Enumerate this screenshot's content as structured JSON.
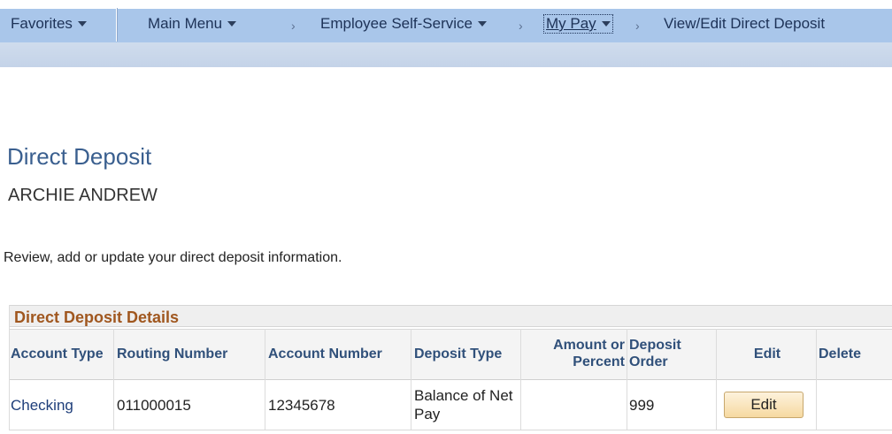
{
  "nav": {
    "favorites": "Favorites",
    "main_menu": "Main Menu",
    "employee_self_service": "Employee Self-Service",
    "my_pay": "My Pay",
    "current_page": "View/Edit Direct Deposit"
  },
  "page": {
    "title": "Direct Deposit",
    "employee_name": "ARCHIE ANDREW",
    "instructions": "Review, add or update your direct deposit information."
  },
  "grid": {
    "title": "Direct Deposit Details",
    "columns": {
      "account_type": "Account Type",
      "routing_number": "Routing Number",
      "account_number": "Account Number",
      "deposit_type": "Deposit Type",
      "amount_line1": "Amount or",
      "amount_line2": "Percent",
      "order_line1": "Deposit",
      "order_line2": "Order",
      "edit": "Edit",
      "delete": "Delete"
    },
    "rows": [
      {
        "account_type": "Checking",
        "routing_number": "011000015",
        "account_number": "12345678",
        "deposit_type_line1": "Balance of Net",
        "deposit_type_line2": "Pay",
        "amount_or_percent": "",
        "deposit_order": "999",
        "edit_label": "Edit"
      }
    ]
  }
}
